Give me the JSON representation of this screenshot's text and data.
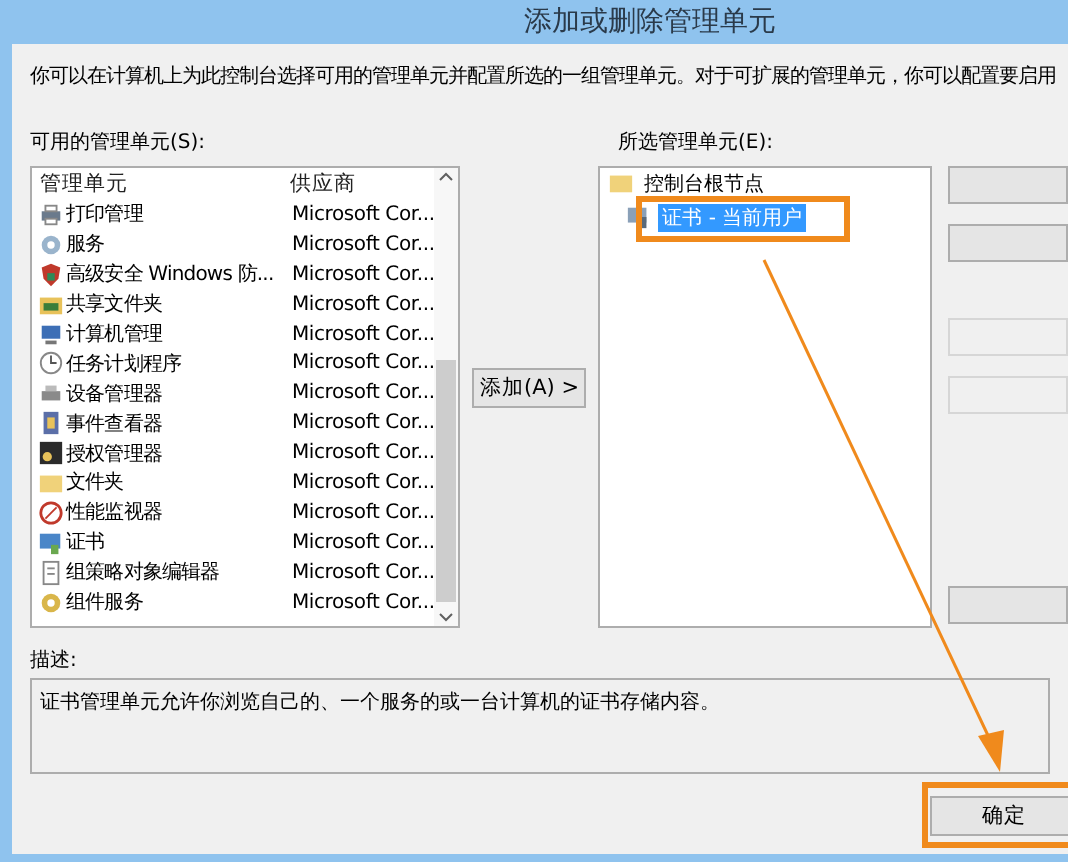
{
  "window": {
    "title": "添加或删除管理单元"
  },
  "instruction": "你可以在计算机上为此控制台选择可用的管理单元并配置所选的一组管理单元。对于可扩展的管理单元，你可以配置要启用",
  "available": {
    "label": "可用的管理单元(S):",
    "columns": [
      "管理单元",
      "供应商"
    ],
    "rows": [
      {
        "name": "打印管理",
        "vendor": "Microsoft Cor..."
      },
      {
        "name": "服务",
        "vendor": "Microsoft Cor..."
      },
      {
        "name": "高级安全 Windows 防...",
        "vendor": "Microsoft Cor..."
      },
      {
        "name": "共享文件夹",
        "vendor": "Microsoft Cor..."
      },
      {
        "name": "计算机管理",
        "vendor": "Microsoft Cor..."
      },
      {
        "name": "任务计划程序",
        "vendor": "Microsoft Cor..."
      },
      {
        "name": "设备管理器",
        "vendor": "Microsoft Cor..."
      },
      {
        "name": "事件查看器",
        "vendor": "Microsoft Cor..."
      },
      {
        "name": "授权管理器",
        "vendor": "Microsoft Cor..."
      },
      {
        "name": "文件夹",
        "vendor": "Microsoft Cor..."
      },
      {
        "name": "性能监视器",
        "vendor": "Microsoft Cor..."
      },
      {
        "name": "证书",
        "vendor": "Microsoft Cor..."
      },
      {
        "name": "组策略对象编辑器",
        "vendor": "Microsoft Cor..."
      },
      {
        "name": "组件服务",
        "vendor": "Microsoft Cor..."
      }
    ]
  },
  "add_button": "添加(A) >",
  "selected": {
    "label": "所选管理单元(E):",
    "tree": [
      {
        "label": "控制台根节点",
        "selected": false,
        "children": [
          {
            "label": "证书 - 当前用户",
            "selected": true
          }
        ]
      }
    ]
  },
  "side_buttons": [
    {
      "disabled": false
    },
    {
      "disabled": false
    },
    {
      "disabled": true
    },
    {
      "disabled": true
    },
    {
      "disabled": false
    }
  ],
  "description": {
    "label": "描述:",
    "text": "证书管理单元允许你浏览自己的、一个服务的或一台计算机的证书存储内容。"
  },
  "ok_button": "确定"
}
